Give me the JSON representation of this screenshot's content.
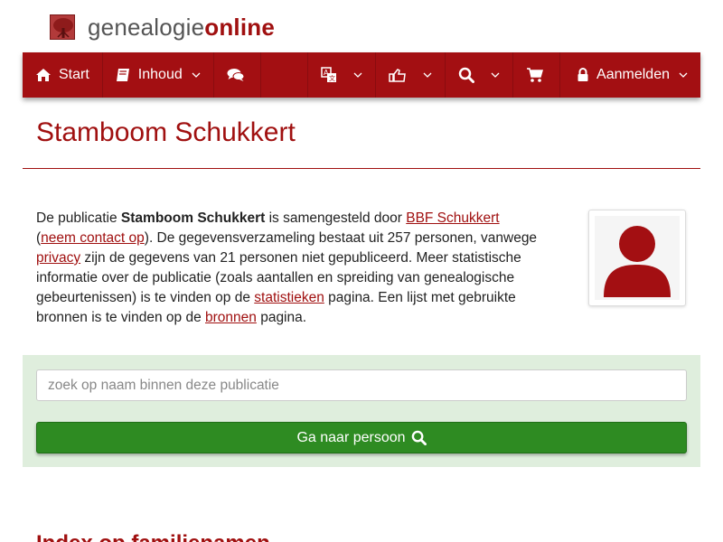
{
  "site": {
    "logo_part1": "genealogie",
    "logo_part2": "online"
  },
  "nav": {
    "start": "Start",
    "inhoud": "Inhoud",
    "aanmelden": "Aanmelden"
  },
  "page": {
    "title": "Stamboom Schukkert"
  },
  "intro": {
    "t1": "De publicatie ",
    "pub_name": "Stamboom Schukkert",
    "t2": " is samengesteld door ",
    "author_link": "BBF Schukkert",
    "t3": "(",
    "contact_link": "neem contact op",
    "t4": "). De gegevensverzameling bestaat uit 257 personen, vanwege ",
    "privacy_link": "privacy",
    "t5": " zijn de gegevens van 21 personen niet gepubliceerd. Meer statistische informatie over de publicatie (zoals aantallen en spreiding van genealogische gebeurtenissen) is te vinden op de ",
    "stats_link": "statistieken",
    "t6": " pagina. Een lijst met gebruikte bronnen is te vinden op de ",
    "sources_link": "bronnen",
    "t7": " pagina."
  },
  "search": {
    "placeholder": "zoek op naam binnen deze publicatie",
    "button_label": "Ga naar persoon"
  },
  "section": {
    "index_heading": "Index op familienamen"
  },
  "colors": {
    "brand_red": "#a30f12",
    "panel_green": "#dfeedd",
    "button_green": "#2e8b22"
  },
  "icons": {
    "home": "home-icon",
    "book": "book-icon",
    "comments": "comments-icon",
    "translate": "translate-icon",
    "thumbs": "thumbs-up-icon",
    "search": "search-icon",
    "cart": "cart-icon",
    "lock": "lock-icon"
  }
}
